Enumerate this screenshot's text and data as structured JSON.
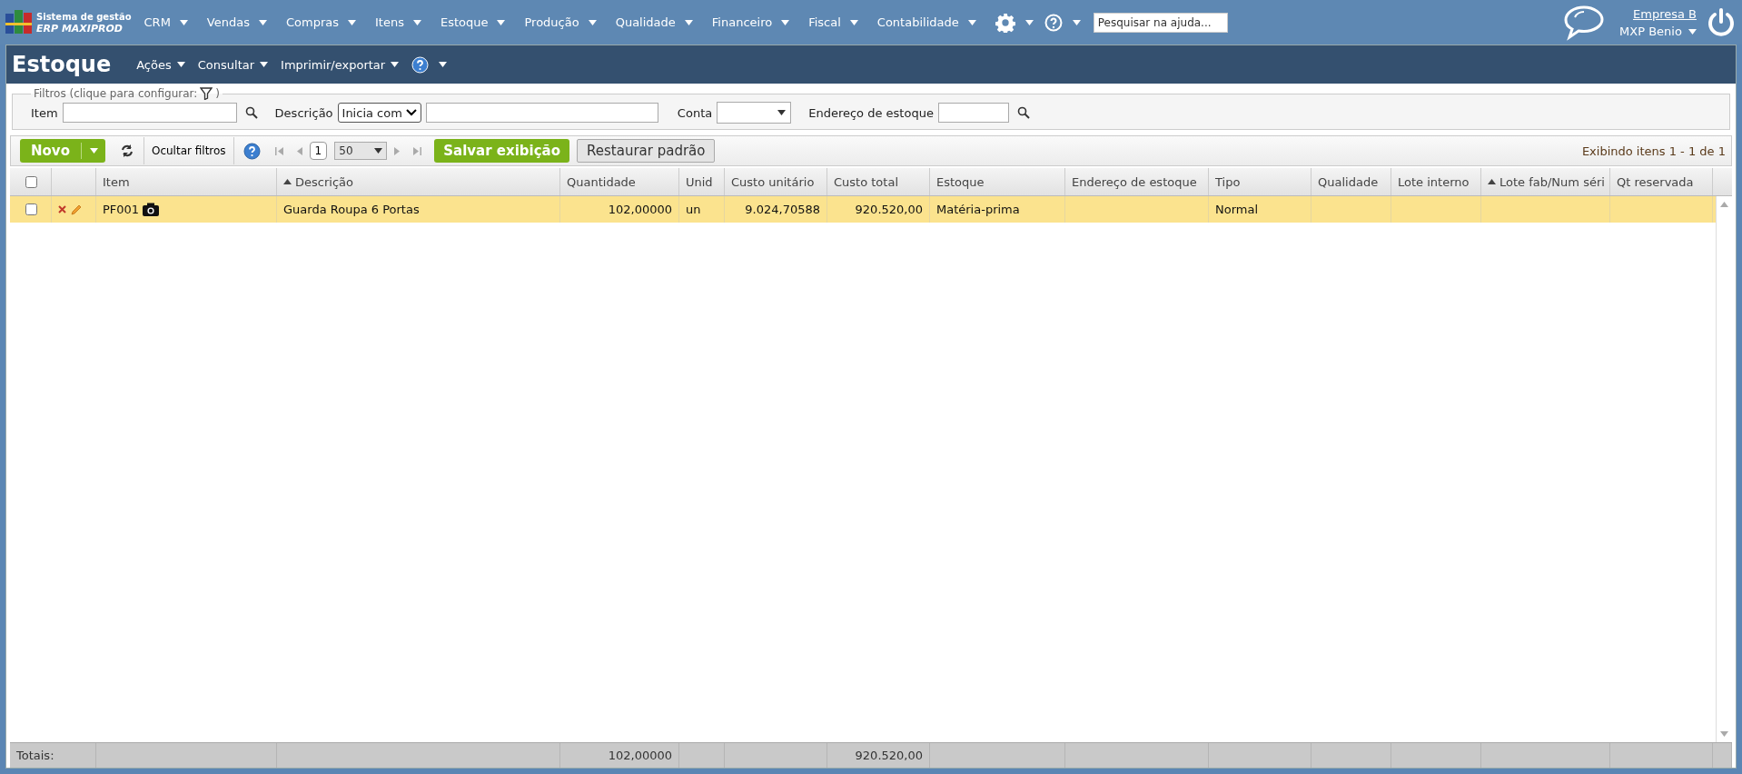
{
  "topbar": {
    "logo_line1": "Sistema de gestão",
    "logo_line2": "ERP MAXIPROD",
    "menus": [
      "CRM",
      "Vendas",
      "Compras",
      "Itens",
      "Estoque",
      "Produção",
      "Qualidade",
      "Financeiro",
      "Fiscal",
      "Contabilidade"
    ],
    "search": {
      "placeholder": "Pesquisar na ajuda..."
    },
    "company": "Empresa B",
    "user": "MXP Benio"
  },
  "module": {
    "title": "Estoque",
    "menus": [
      "Ações",
      "Consultar",
      "Imprimir/exportar"
    ]
  },
  "filters": {
    "legend": "Filtros (clique para configurar:",
    "legend_end": ")",
    "item_label": "Item",
    "description_label": "Descrição",
    "description_mode": "Inicia com",
    "account_label": "Conta",
    "address_label": "Endereço de estoque"
  },
  "toolbar": {
    "new": "Novo",
    "hide_filters": "Ocultar filtros",
    "page": "1",
    "page_size": "50",
    "save_view": "Salvar exibição",
    "restore": "Restaurar padrão",
    "summary": "Exibindo itens 1 - 1 de 1"
  },
  "table": {
    "columns": [
      {
        "label": "Item",
        "sorted": false
      },
      {
        "label": "Descrição",
        "sorted": true
      },
      {
        "label": "Quantidade",
        "sorted": false
      },
      {
        "label": "Unid",
        "sorted": false
      },
      {
        "label": "Custo unitário",
        "sorted": false
      },
      {
        "label": "Custo total",
        "sorted": false
      },
      {
        "label": "Estoque",
        "sorted": false
      },
      {
        "label": "Endereço de estoque",
        "sorted": false
      },
      {
        "label": "Tipo",
        "sorted": false
      },
      {
        "label": "Qualidade",
        "sorted": false
      },
      {
        "label": "Lote interno",
        "sorted": false
      },
      {
        "label": "Lote fab/Num séri",
        "sorted": true
      },
      {
        "label": "Qt reservada",
        "sorted": false
      }
    ],
    "header_checked": false,
    "rows": [
      {
        "selected": true,
        "checked": false,
        "item": "PF001",
        "description": "Guarda Roupa 6 Portas",
        "quantity": "102,00000",
        "unit": "un",
        "unit_cost": "9.024,70588",
        "total_cost": "920.520,00",
        "stock": "Matéria-prima",
        "type": "Normal"
      }
    ],
    "totals_label": "Totais:",
    "totals": {
      "quantity": "102,00000",
      "total_cost": "920.520,00"
    }
  }
}
